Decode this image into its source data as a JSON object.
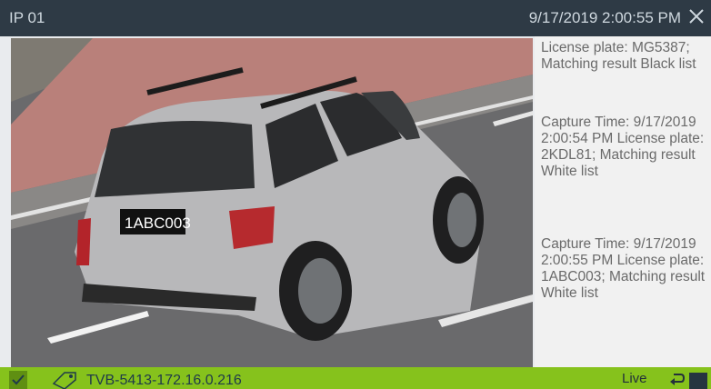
{
  "title_bar": {
    "camera_name": "IP 01",
    "timestamp": "9/17/2019 2:00:55 PM",
    "close_icon": "close-icon"
  },
  "video": {
    "plate_text": "1ABC003"
  },
  "event_log": {
    "entries": [
      {
        "text": "License plate: MG5387; Matching result Black list"
      },
      {
        "text": "Capture Time: 9/17/2019 2:00:54 PM License plate: 2KDL81; Matching result White list"
      },
      {
        "text": "Capture Time: 9/17/2019 2:00:55 PM License plate: 1ABC003; Matching result White list"
      }
    ]
  },
  "status_bar": {
    "device_label": "TVB-5413-172.16.0.216",
    "live_label": "Live",
    "checkbox_icon": "check-icon",
    "tag_icon": "tag-icon",
    "back_icon": "rewind-icon",
    "stop_icon": "stop-icon"
  },
  "colors": {
    "title_bar": "#2e3a45",
    "status_bar": "#86c21c",
    "log_panel": "#f1f1f1"
  }
}
